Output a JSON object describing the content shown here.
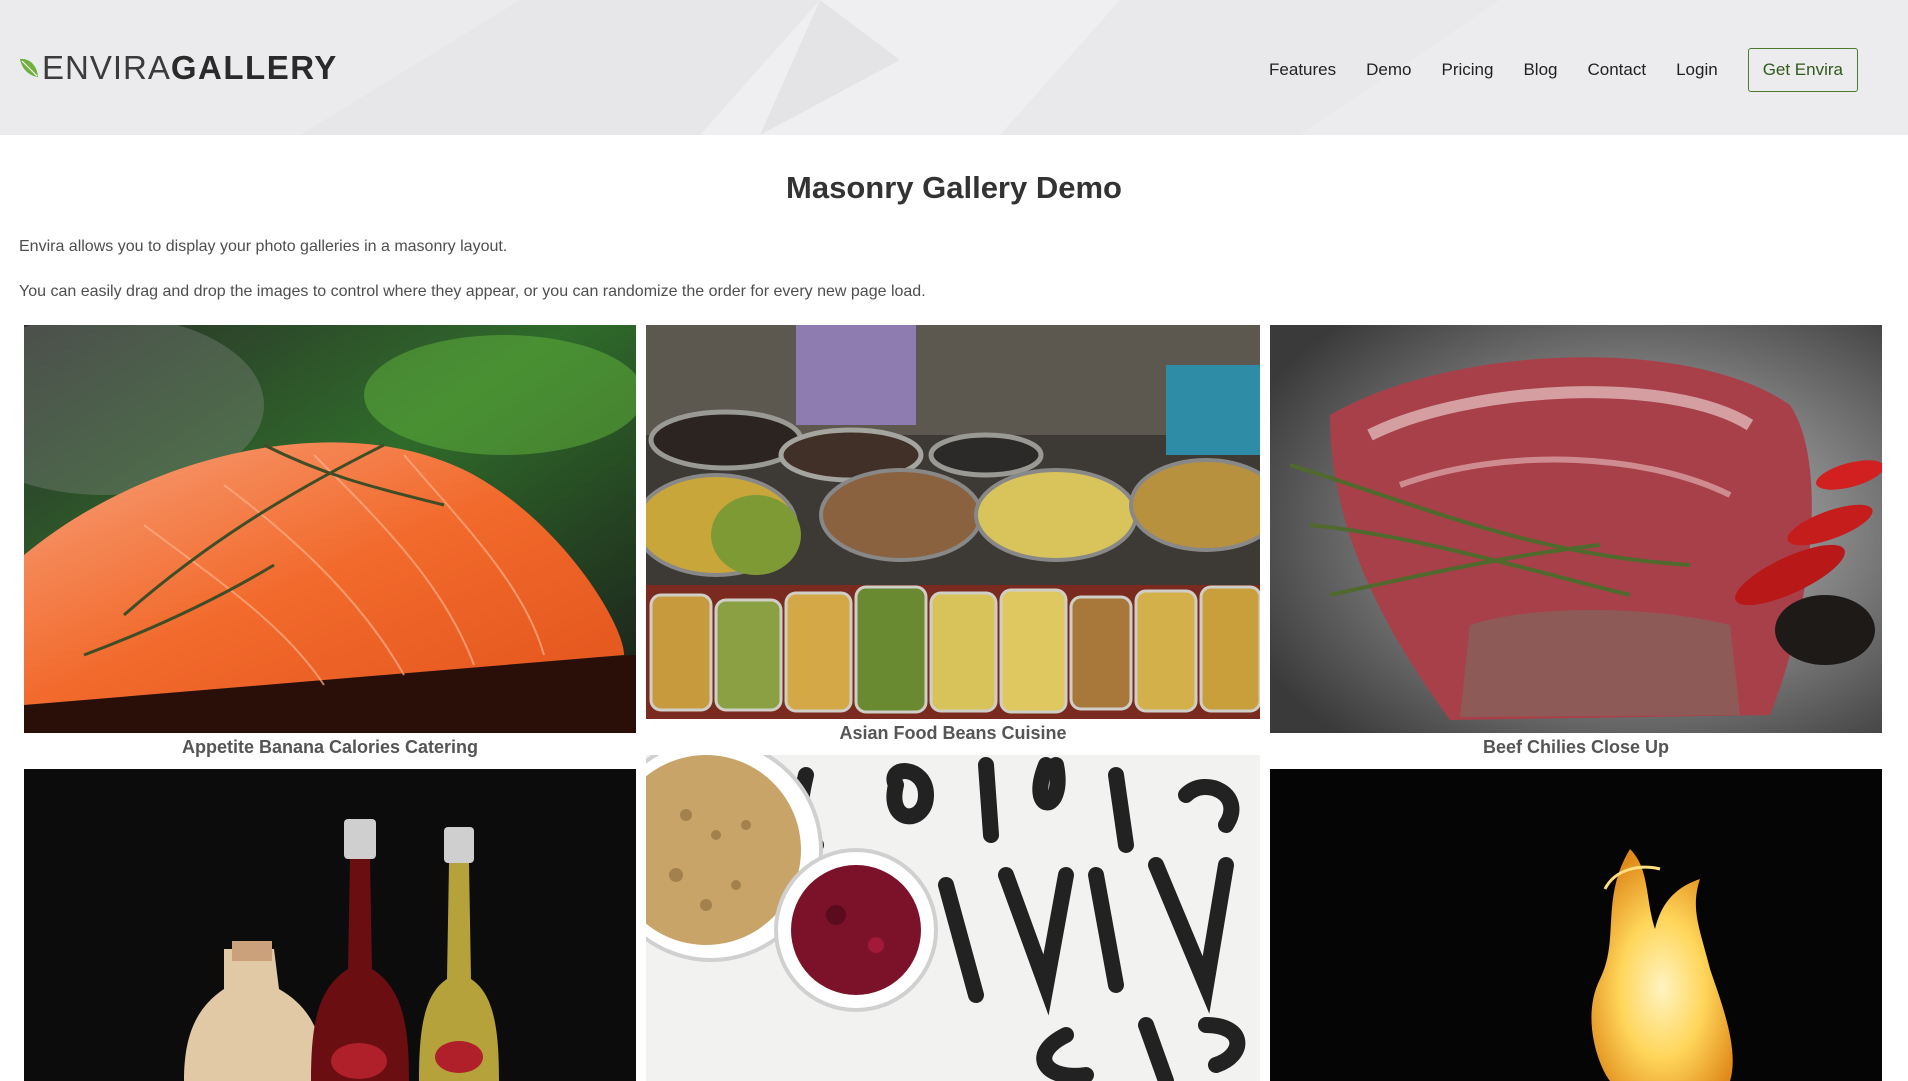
{
  "header": {
    "logo": {
      "part1": "ENVIRA",
      "part2": "GALLERY",
      "icon": "leaf-icon",
      "icon_color": "#6bb13a"
    },
    "nav": [
      "Features",
      "Demo",
      "Pricing",
      "Blog",
      "Contact",
      "Login"
    ],
    "cta_label": "Get Envira"
  },
  "main": {
    "title": "Masonry Gallery Demo",
    "paragraphs": [
      "Envira allows you to display your photo galleries in a masonry layout.",
      "You can easily drag and drop the images to control where they appear, or you can randomize the order for every new page load."
    ]
  },
  "gallery": {
    "items": [
      {
        "caption": "Appetite Banana Calories Catering"
      },
      {
        "caption": "Asian Food Beans Cuisine"
      },
      {
        "caption": "Beef Chilies Close Up"
      },
      {
        "caption": ""
      },
      {
        "caption": ""
      },
      {
        "caption": ""
      }
    ]
  },
  "colors": {
    "accent": "#4c7a2e",
    "header_bg": "#eeeef0",
    "text": "#333333"
  }
}
